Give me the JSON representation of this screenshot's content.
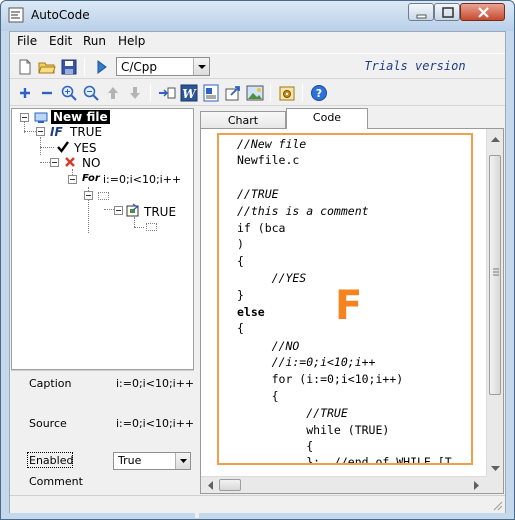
{
  "window": {
    "title": "AutoCode"
  },
  "menu": [
    "File",
    "Edit",
    "Run",
    "Help"
  ],
  "toolbar": {
    "language": "C/Cpp",
    "trials_label": "Trials version"
  },
  "tree": {
    "root": "New file",
    "if_keyword": "IF",
    "if_condition": "TRUE",
    "yes_label": "YES",
    "no_label": "NO",
    "for_keyword": "For",
    "for_condition": "i:=0;i<10;i++",
    "while_condition": "TRUE"
  },
  "properties": {
    "caption_label": "Caption",
    "caption_value": "i:=0;i<10;i++",
    "source_label": "Source",
    "source_value": "i:=0;i<10;i++",
    "enabled_label": "Enabled",
    "enabled_value": "True",
    "comment_label": "Comment"
  },
  "tabs": [
    {
      "label": "Chart",
      "active": false
    },
    {
      "label": "Code",
      "active": true
    }
  ],
  "code": {
    "overlay_letter": "F",
    "lines": [
      "//New file",
      "Newfile.c",
      "",
      "//TRUE",
      "//this is a comment",
      "if (bca",
      ")",
      "{",
      "     //YES",
      "}",
      "else",
      "{",
      "     //NO",
      "     //i:=0;i<10;i++",
      "     for (i:=0;i<10;i++)",
      "     {",
      "          //TRUE",
      "          while (TRUE)",
      "          {",
      "          };  //end of WHILE [T"
    ]
  },
  "colors": {
    "highlight_border": "#f0a04b",
    "overlay_letter": "#f5831f",
    "trials_text": "#1f3e8a"
  }
}
